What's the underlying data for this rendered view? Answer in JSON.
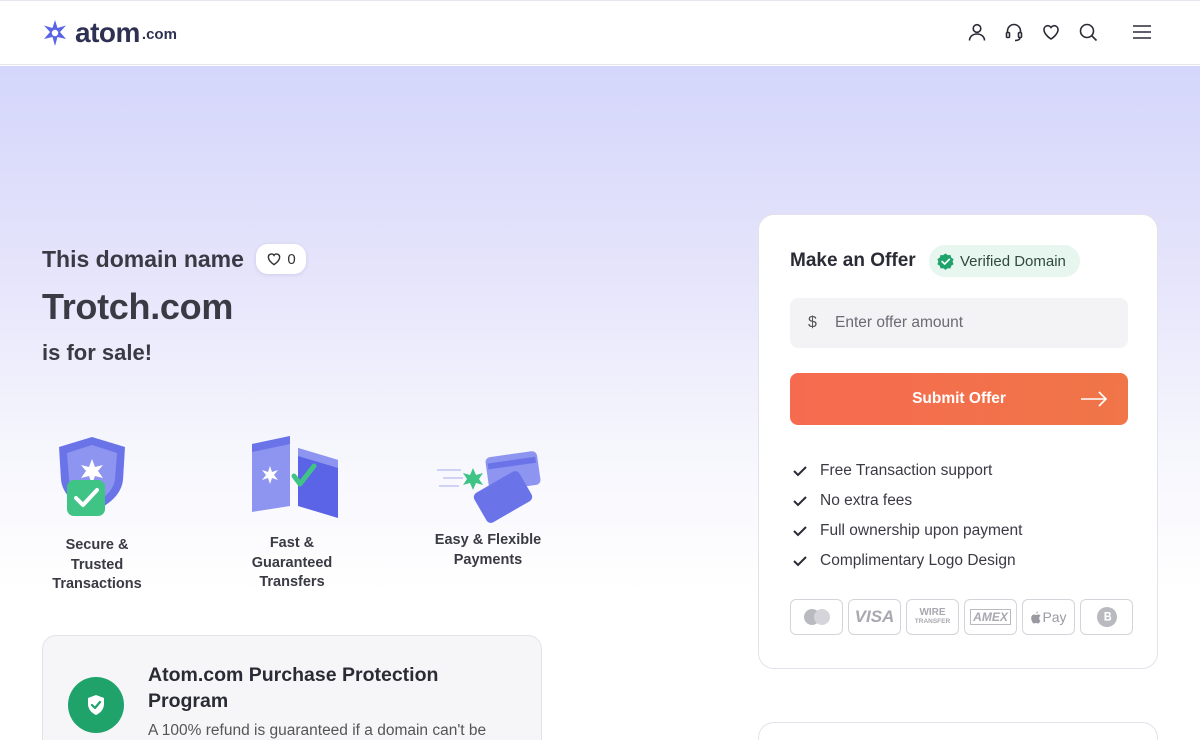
{
  "header": {
    "logo_text": "atom",
    "logo_domain": ".com",
    "icons": [
      "user-icon",
      "headset-icon",
      "heart-icon",
      "search-icon",
      "menu-icon"
    ]
  },
  "hero": {
    "pre_title": "This domain name",
    "favorites_count": "0",
    "domain_name": "Trotch.com",
    "post_title": "is for sale!"
  },
  "features": [
    {
      "label": "Secure & Trusted Transactions",
      "line1": "Secure &",
      "line2": "Trusted",
      "line3": "Transactions"
    },
    {
      "label": "Fast & Guaranteed Transfers",
      "line1": "Fast &",
      "line2": "Guaranteed",
      "line3": "Transfers"
    },
    {
      "label": "Easy & Flexible Payments",
      "line1": "Easy & Flexible",
      "line2": "Payments"
    }
  ],
  "protection": {
    "title": "Atom.com Purchase Protection Program",
    "text": "A 100% refund is guaranteed if a domain can't be"
  },
  "offer": {
    "title": "Make an Offer",
    "verified_label": "Verified Domain",
    "currency_symbol": "$",
    "input_placeholder": "Enter offer amount",
    "submit_label": "Submit Offer",
    "benefits": [
      "Free Transaction support",
      "No extra fees",
      "Full ownership upon payment",
      "Complimentary Logo Design"
    ],
    "payment_methods": [
      "mastercard",
      "VISA",
      "WIRE TRANSFER",
      "AMEX",
      "Pay",
      "bitcoin"
    ],
    "visa_text": "VISA",
    "wire_text_1": "WIRE",
    "wire_text_2": "TRANSFER",
    "amex_text": "AMEX",
    "applepay_text": "Pay"
  },
  "colors": {
    "accent": "#f66b50",
    "brand": "#5b63e6",
    "verified": "#1fa36b",
    "text": "#2b2b36"
  }
}
